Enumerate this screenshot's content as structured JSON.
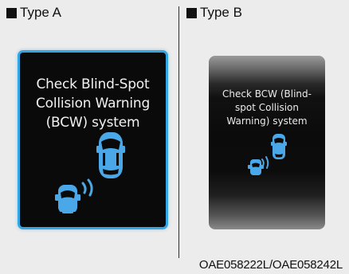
{
  "type_a": {
    "label": "Type A",
    "message_lines": [
      "Check Blind-Spot",
      "Collision Warning",
      "(BCW) system"
    ],
    "illustration_icon": "blind-spot-cars-icon",
    "border_color": "#33a6e4"
  },
  "type_b": {
    "label": "Type B",
    "message_lines": [
      "Check BCW (Blind-",
      "spot Collision",
      "Warning) system"
    ],
    "illustration_icon": "blind-spot-cars-icon"
  },
  "figure_code": "OAE058222L/OAE058242L"
}
